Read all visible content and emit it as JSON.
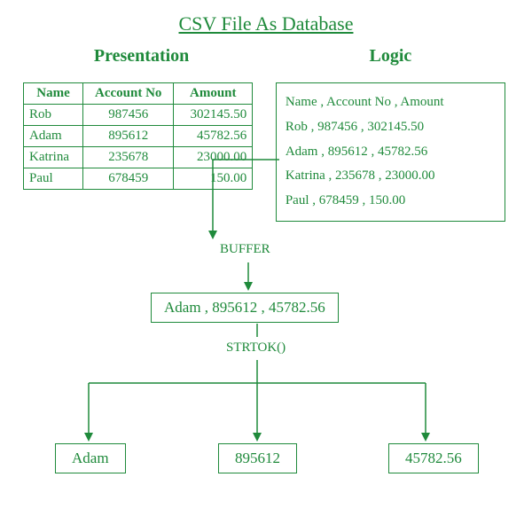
{
  "title": "CSV File As Database",
  "presentation": {
    "heading": "Presentation",
    "headers": [
      "Name",
      "Account No",
      "Amount"
    ],
    "rows": [
      {
        "name": "Rob",
        "acct": "987456",
        "amount": "302145.50"
      },
      {
        "name": "Adam",
        "acct": "895612",
        "amount": "45782.56"
      },
      {
        "name": "Katrina",
        "acct": "235678",
        "amount": "23000.00"
      },
      {
        "name": "Paul",
        "acct": "678459",
        "amount": "150.00"
      }
    ]
  },
  "logic": {
    "heading": "Logic",
    "lines": [
      "Name , Account No , Amount",
      "Rob , 987456 , 302145.50",
      "Adam , 895612 , 45782.56",
      "Katrina , 235678 , 23000.00",
      "Paul , 678459 , 150.00"
    ]
  },
  "buffer": {
    "label": "BUFFER",
    "line": "Adam , 895612 , 45782.56"
  },
  "strtok": {
    "label": "STRTOK()",
    "tokens": [
      "Adam",
      "895612",
      "45782.56"
    ]
  },
  "colors": {
    "accent": "#1f8a3b"
  }
}
